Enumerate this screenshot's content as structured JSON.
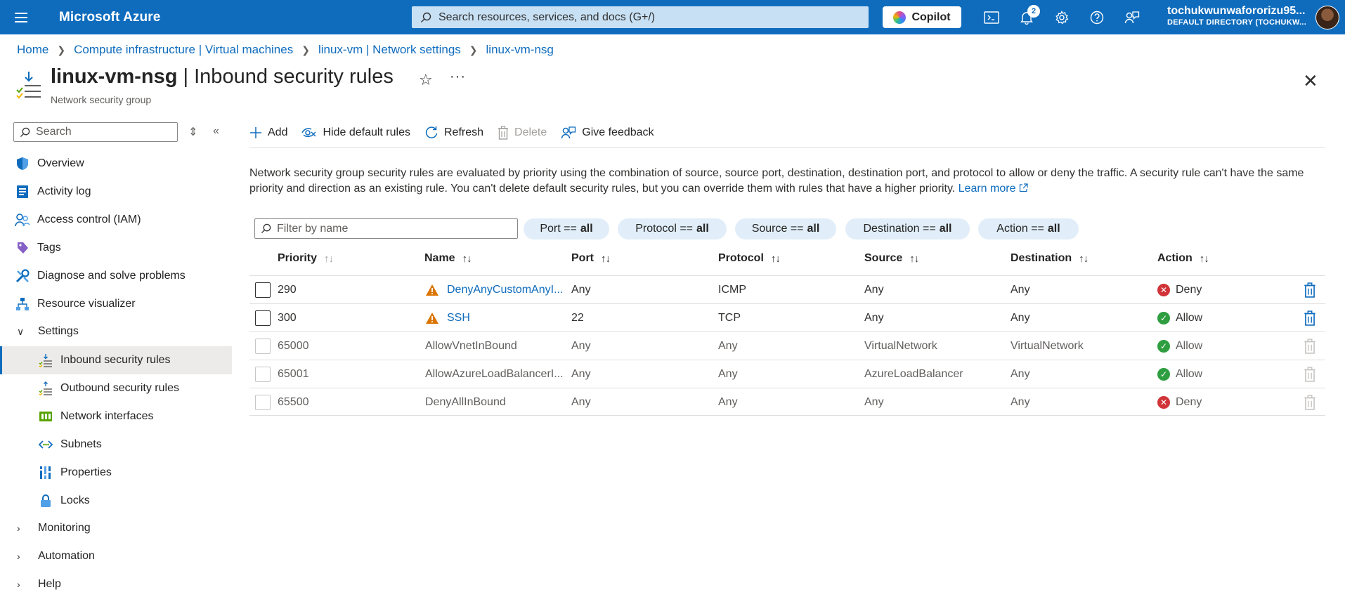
{
  "topbar": {
    "brand": "Microsoft Azure",
    "search_placeholder": "Search resources, services, and docs (G+/)",
    "copilot_label": "Copilot",
    "notifications_count": "2",
    "user_name": "tochukwunwafororizu95...",
    "user_directory": "DEFAULT DIRECTORY (TOCHUKW..."
  },
  "breadcrumb": [
    "Home",
    "Compute infrastructure | Virtual machines",
    "linux-vm | Network settings",
    "linux-vm-nsg"
  ],
  "header": {
    "resource": "linux-vm-nsg",
    "separator": " | ",
    "page": "Inbound security rules",
    "subtitle": "Network security group"
  },
  "sidebar": {
    "search_placeholder": "Search",
    "items": [
      {
        "label": "Overview",
        "icon": "shield-icon"
      },
      {
        "label": "Activity log",
        "icon": "activity-log-icon"
      },
      {
        "label": "Access control (IAM)",
        "icon": "people-icon"
      },
      {
        "label": "Tags",
        "icon": "tag-icon"
      },
      {
        "label": "Diagnose and solve problems",
        "icon": "wrench-icon"
      },
      {
        "label": "Resource visualizer",
        "icon": "hierarchy-icon"
      }
    ],
    "settings_label": "Settings",
    "settings_items": [
      {
        "label": "Inbound security rules",
        "icon": "inbound-rules-icon",
        "active": true
      },
      {
        "label": "Outbound security rules",
        "icon": "outbound-rules-icon"
      },
      {
        "label": "Network interfaces",
        "icon": "network-interface-icon"
      },
      {
        "label": "Subnets",
        "icon": "subnet-icon"
      },
      {
        "label": "Properties",
        "icon": "properties-icon"
      },
      {
        "label": "Locks",
        "icon": "lock-icon"
      }
    ],
    "groups": [
      "Monitoring",
      "Automation",
      "Help"
    ]
  },
  "toolbar": {
    "add": "Add",
    "hide_default": "Hide default rules",
    "refresh": "Refresh",
    "delete": "Delete",
    "feedback": "Give feedback"
  },
  "description": {
    "text": "Network security group security rules are evaluated by priority using the combination of source, source port, destination, destination port, and protocol to allow or deny the traffic. A security rule can't have the same priority and direction as an existing rule. You can't delete default security rules, but you can override them with rules that have a higher priority.",
    "learn_more": "Learn more"
  },
  "filters": {
    "name_placeholder": "Filter by name",
    "pills": [
      {
        "key": "Port ==",
        "value": "all"
      },
      {
        "key": "Protocol ==",
        "value": "all"
      },
      {
        "key": "Source ==",
        "value": "all"
      },
      {
        "key": "Destination ==",
        "value": "all"
      },
      {
        "key": "Action ==",
        "value": "all"
      }
    ]
  },
  "table": {
    "columns": [
      "Priority",
      "Name",
      "Port",
      "Protocol",
      "Source",
      "Destination",
      "Action"
    ],
    "rows": [
      {
        "priority": "290",
        "name": "DenyAnyCustomAnyI...",
        "port": "Any",
        "protocol": "ICMP",
        "source": "Any",
        "destination": "Any",
        "action": "Deny",
        "custom": true,
        "warning": true
      },
      {
        "priority": "300",
        "name": "SSH",
        "port": "22",
        "protocol": "TCP",
        "source": "Any",
        "destination": "Any",
        "action": "Allow",
        "custom": true,
        "warning": true
      },
      {
        "priority": "65000",
        "name": "AllowVnetInBound",
        "port": "Any",
        "protocol": "Any",
        "source": "VirtualNetwork",
        "destination": "VirtualNetwork",
        "action": "Allow",
        "custom": false,
        "warning": false
      },
      {
        "priority": "65001",
        "name": "AllowAzureLoadBalancerI...",
        "port": "Any",
        "protocol": "Any",
        "source": "AzureLoadBalancer",
        "destination": "Any",
        "action": "Allow",
        "custom": false,
        "warning": false
      },
      {
        "priority": "65500",
        "name": "DenyAllInBound",
        "port": "Any",
        "protocol": "Any",
        "source": "Any",
        "destination": "Any",
        "action": "Deny",
        "custom": false,
        "warning": false
      }
    ]
  },
  "colors": {
    "brand_blue": "#0f6cbd",
    "allow_green": "#2e9e40",
    "deny_red": "#d13438",
    "warning_orange": "#db7500"
  }
}
